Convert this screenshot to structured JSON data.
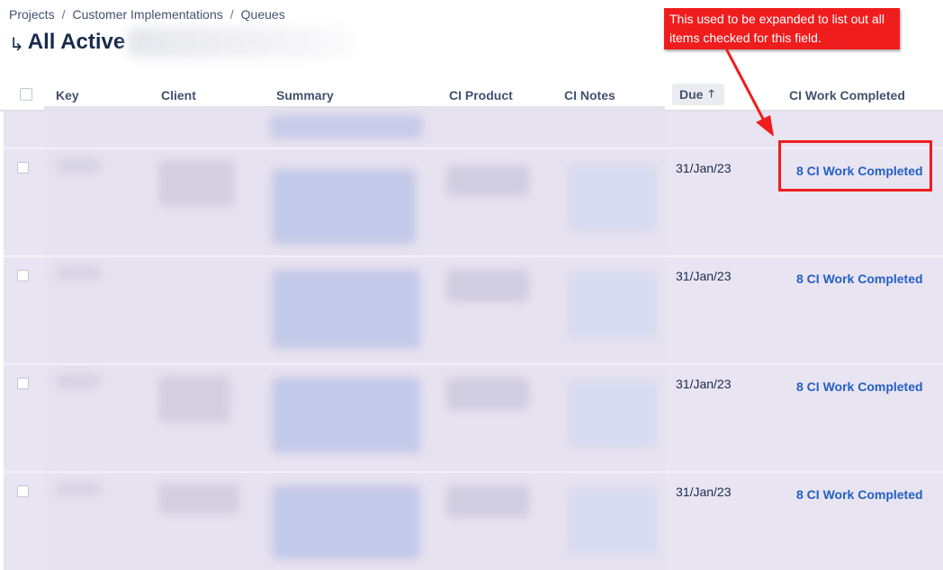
{
  "breadcrumb": {
    "items": [
      "Projects",
      "Customer Implementations",
      "Queues"
    ],
    "separator": "/"
  },
  "page": {
    "title": "All Active",
    "title_icon": "return-arrow-icon"
  },
  "table": {
    "columns": [
      "Key",
      "Client",
      "Summary",
      "CI Product",
      "CI Notes",
      "Due",
      "CI Work Completed"
    ],
    "sort_column": "Due",
    "sort_icon": "arrow-up-icon",
    "rows": [
      {
        "due": "31/Jan/23",
        "ci_work_completed": "8 CI Work Completed"
      },
      {
        "due": "31/Jan/23",
        "ci_work_completed": "8 CI Work Completed"
      },
      {
        "due": "31/Jan/23",
        "ci_work_completed": "8 CI Work Completed"
      },
      {
        "due": "31/Jan/23",
        "ci_work_completed": "8 CI Work Completed"
      }
    ]
  },
  "annotation": {
    "text": "This used to be expanded to list out all items checked for this field.",
    "color": "#ef1d1d"
  },
  "colors": {
    "link": "#2360c6",
    "row_background": "#e9e4f1"
  }
}
